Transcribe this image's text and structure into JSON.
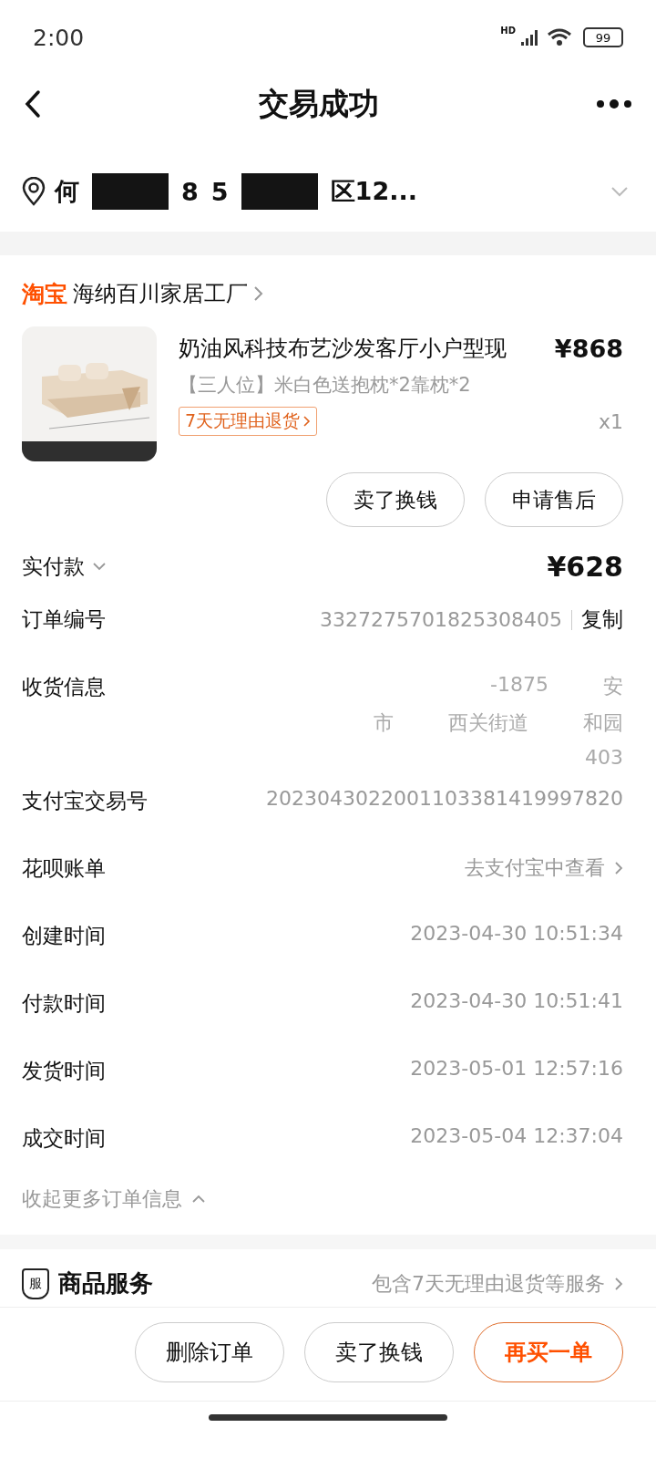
{
  "status_bar": {
    "time": "2:00",
    "network": "HD",
    "battery": "99"
  },
  "header": {
    "title": "交易成功"
  },
  "address": {
    "fragments": [
      {
        "kind": "text",
        "text": "何"
      },
      {
        "kind": "redaction"
      },
      {
        "kind": "text",
        "text": "8"
      },
      {
        "kind": "text",
        "text": "5"
      },
      {
        "kind": "redaction"
      },
      {
        "kind": "text",
        "text": "区12..."
      }
    ]
  },
  "shop": {
    "brand": "淘宝",
    "name": "海纳百川家居工厂"
  },
  "product": {
    "title": "奶油风科技布艺沙发客厅小户型现",
    "price": "¥868",
    "variant": "【三人位】米白色送抱枕*2靠枕*2",
    "tag": "7天无理由退货",
    "quantity": "x1",
    "buttons": [
      "卖了换钱",
      "申请售后"
    ]
  },
  "paid": {
    "label": "实付款",
    "amount": "¥628"
  },
  "info_rows": [
    {
      "kind": "copy",
      "label": "订单编号",
      "value": "3327275701825308405",
      "action": "复制"
    },
    {
      "kind": "address",
      "label": "收货信息",
      "lines": [
        [
          "-1875",
          "安"
        ],
        [
          "市",
          "西关街道",
          "和园"
        ],
        [
          "403"
        ]
      ]
    },
    {
      "kind": "text",
      "label": "支付宝交易号",
      "value": "2023043022001103381419997820"
    },
    {
      "kind": "link",
      "label": "花呗账单",
      "value": "去支付宝中查看"
    },
    {
      "kind": "text",
      "label": "创建时间",
      "value": "2023-04-30 10:51:34"
    },
    {
      "kind": "text",
      "label": "付款时间",
      "value": "2023-04-30 10:51:41"
    },
    {
      "kind": "text",
      "label": "发货时间",
      "value": "2023-05-01 12:57:16"
    },
    {
      "kind": "text",
      "label": "成交时间",
      "value": "2023-05-04 12:37:04"
    }
  ],
  "collapse_link": "收起更多订单信息",
  "service": {
    "badge": "服",
    "title": "商品服务",
    "summary": "包含7天无理由退货等服务"
  },
  "bottom_buttons": [
    {
      "label": "删除订单",
      "primary": false
    },
    {
      "label": "卖了换钱",
      "primary": false
    },
    {
      "label": "再买一单",
      "primary": true
    }
  ]
}
